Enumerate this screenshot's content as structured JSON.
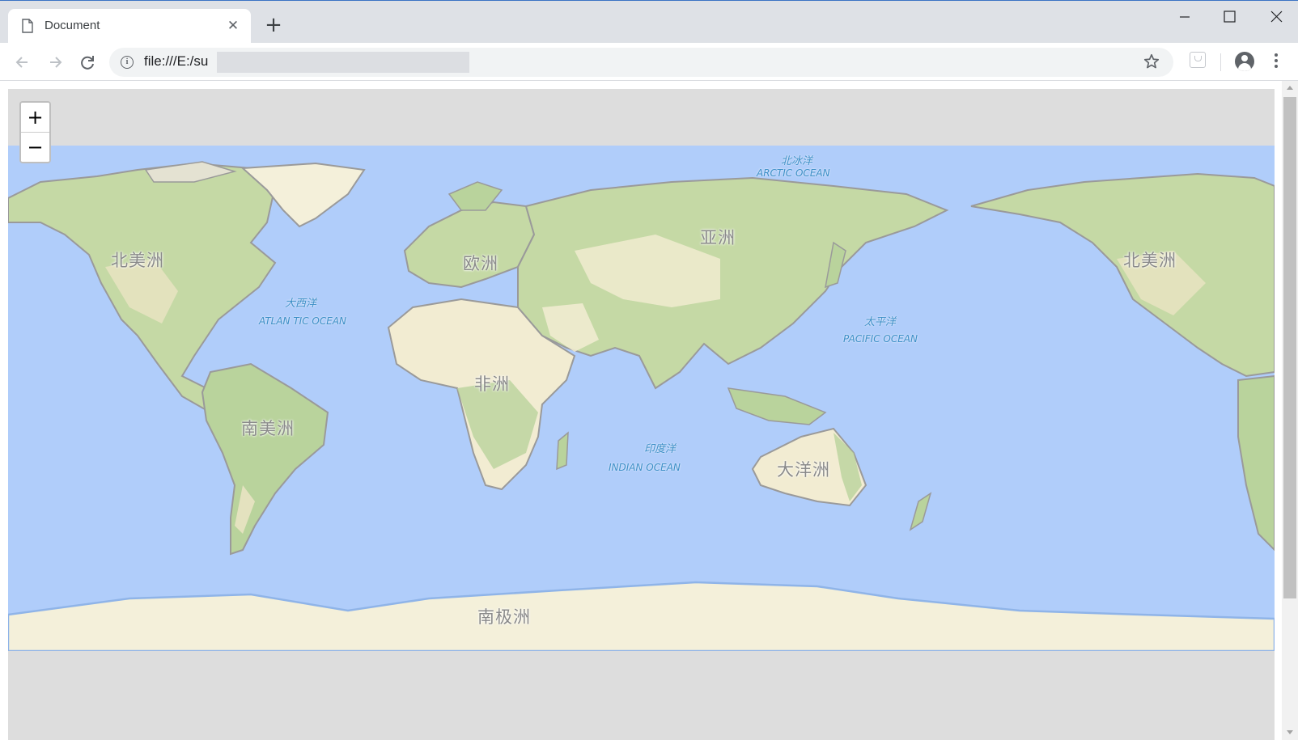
{
  "browser": {
    "tab_title": "Document",
    "url": "file:///E:/su",
    "new_tab_label": "+",
    "close_tab_label": "✕"
  },
  "map": {
    "zoom_in_label": "+",
    "zoom_out_label": "−",
    "continents": {
      "north_america_left": "北美洲",
      "north_america_right": "北美洲",
      "south_america": "南美洲",
      "europe": "欧洲",
      "africa": "非洲",
      "asia": "亚洲",
      "oceania": "大洋洲",
      "antarctica": "南极洲"
    },
    "oceans": {
      "arctic_cn": "北冰洋",
      "arctic_en": "ARCTIC OCEAN",
      "atlantic_cn": "大西洋",
      "atlantic_en": "ATLAN TIC OCEAN",
      "pacific_cn": "太平洋",
      "pacific_en": "PACIFIC OCEAN",
      "indian_cn": "印度洋",
      "indian_en": "INDIAN OCEAN"
    },
    "colors": {
      "ocean": "#b0cdfa",
      "land_green": "#b9d39c",
      "land_tan": "#f2ecd2",
      "ice": "#f4f0da",
      "border": "#9a9a9a",
      "background": "#dddddd"
    }
  }
}
